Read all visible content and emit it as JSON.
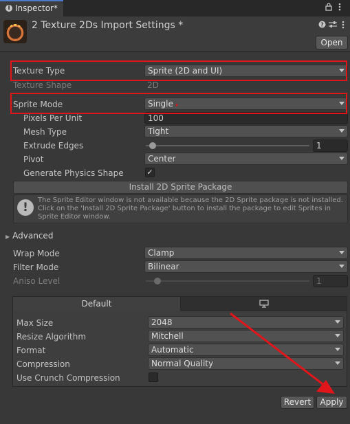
{
  "window": {
    "tab_title": "Inspector*",
    "tab_icon": "info-icon",
    "lock_icon": "lock-icon",
    "menu_icon": "kebab-menu-icon"
  },
  "header": {
    "title": "2 Texture 2Ds Import Settings *",
    "help_icon": "help-icon",
    "preset_icon": "presets-icon",
    "more_icon": "kebab-menu-icon",
    "open_button": "Open"
  },
  "fields": {
    "texture_type": {
      "label": "Texture Type",
      "value": "Sprite (2D and UI)"
    },
    "texture_shape": {
      "label": "Texture Shape",
      "value": "2D"
    },
    "sprite_mode": {
      "label": "Sprite Mode",
      "value": "Single"
    },
    "pixels_per_unit": {
      "label": "Pixels Per Unit",
      "value": "100"
    },
    "mesh_type": {
      "label": "Mesh Type",
      "value": "Tight"
    },
    "extrude_edges": {
      "label": "Extrude Edges",
      "value": "1",
      "slider_fraction": 0.04
    },
    "pivot": {
      "label": "Pivot",
      "value": "Center"
    },
    "generate_physics_shape": {
      "label": "Generate Physics Shape",
      "checked": true,
      "check_glyph": "✓"
    }
  },
  "install_button": "Install 2D Sprite Package",
  "help_message": "The Sprite Editor window is not available because the 2D Sprite package is not installed. Click on the 'Install 2D Sprite Package' button to install the package to edit Sprites in Sprite Editor window.",
  "help_icon_glyph": "!",
  "advanced": {
    "label": "Advanced",
    "expanded": false,
    "arrow": "▶"
  },
  "sampling": {
    "wrap_mode": {
      "label": "Wrap Mode",
      "value": "Clamp"
    },
    "filter_mode": {
      "label": "Filter Mode",
      "value": "Bilinear"
    },
    "aniso_level": {
      "label": "Aniso Level",
      "value": "1",
      "slider_fraction": 0.04,
      "disabled": true
    }
  },
  "platform": {
    "tabs": [
      {
        "label": "Default",
        "active": true
      },
      {
        "label": "",
        "icon": "monitor-icon",
        "active": false
      }
    ],
    "max_size": {
      "label": "Max Size",
      "value": "2048"
    },
    "resize_algorithm": {
      "label": "Resize Algorithm",
      "value": "Mitchell"
    },
    "format": {
      "label": "Format",
      "value": "Automatic"
    },
    "compression": {
      "label": "Compression",
      "value": "Normal Quality"
    },
    "use_crunch": {
      "label": "Use Crunch Compression",
      "checked": false
    }
  },
  "footer": {
    "revert": "Revert",
    "apply": "Apply"
  },
  "colors": {
    "annotation_red": "#e0161b",
    "panel_bg": "#383838",
    "field_bg": "#515151",
    "tab_accent": "#4d78cc"
  }
}
